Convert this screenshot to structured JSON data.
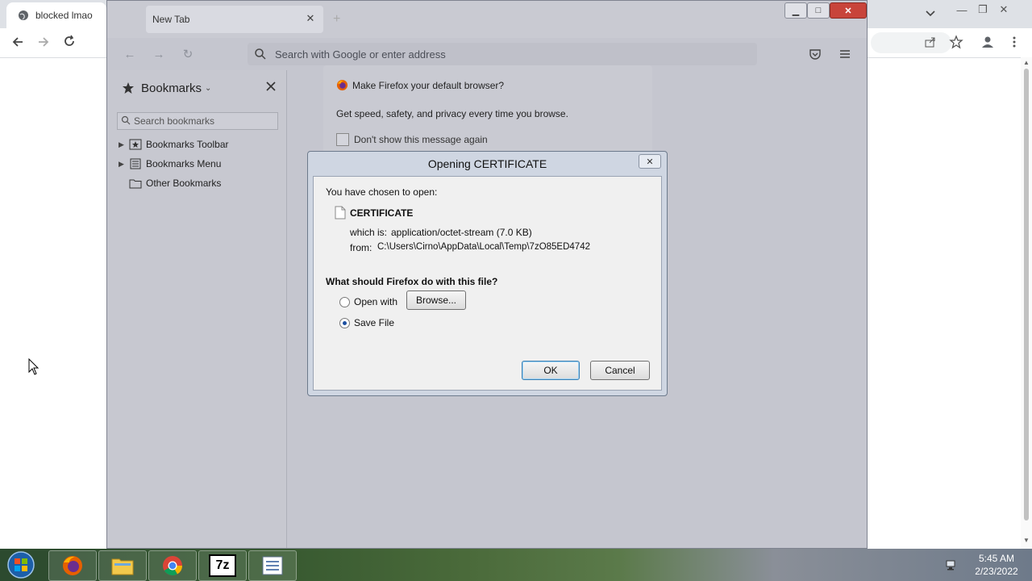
{
  "chrome": {
    "tab_title": "blocked lmao"
  },
  "firefox": {
    "tab_label": "New Tab",
    "url_placeholder": "Search with Google or enter address",
    "sidebar": {
      "title": "Bookmarks",
      "search_placeholder": "Search bookmarks",
      "items": [
        {
          "label": "Bookmarks Toolbar",
          "icon": "bookmarks-toolbar-icon",
          "expandable": true
        },
        {
          "label": "Bookmarks Menu",
          "icon": "bookmarks-menu-icon",
          "expandable": true
        },
        {
          "label": "Other Bookmarks",
          "icon": "folder-icon",
          "expandable": false
        }
      ]
    },
    "default_prompt": {
      "title": "Make Firefox your default browser?",
      "body": "Get speed, safety, and privacy every time you browse.",
      "checkbox_label": "Don't show this message again"
    }
  },
  "dialog": {
    "title": "Opening CERTIFICATE",
    "intro": "You have chosen to open:",
    "file_name": "CERTIFICATE",
    "which_is_label": "which is:",
    "which_is_value": "application/octet-stream (7.0 KB)",
    "from_label": "from:",
    "from_value": "C:\\Users\\Cirno\\AppData\\Local\\Temp\\7zO85ED4742",
    "question": "What should Firefox do with this file?",
    "open_with_label": "Open with",
    "browse_label": "Browse...",
    "save_file_label": "Save File",
    "selected_action": "save_file",
    "ok_label": "OK",
    "cancel_label": "Cancel"
  },
  "taskbar": {
    "time": "5:45 AM",
    "date": "2/23/2022",
    "apps": [
      "firefox-icon",
      "file-explorer-icon",
      "chrome-icon",
      "7zip-icon",
      "task-list-icon"
    ],
    "sevenzip_label": "7z"
  },
  "colors": {
    "dialog_frame": "#cfd6e2",
    "firefox_overlay": "#c5c6cf",
    "prompt_primary": "#2c75d6"
  }
}
